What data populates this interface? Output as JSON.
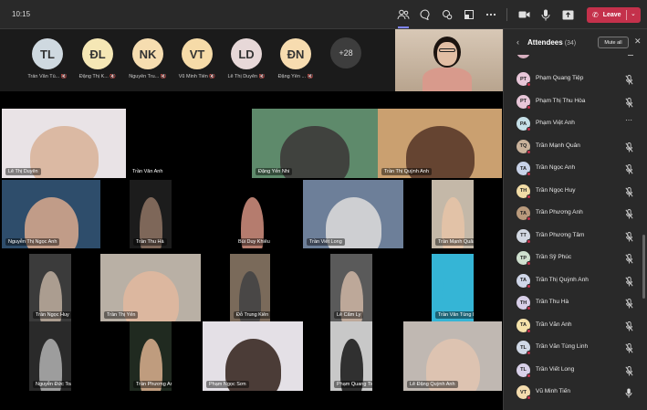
{
  "top_bar": {
    "time": "10:15",
    "leave_label": "Leave",
    "icons": [
      "people-icon",
      "chat-icon",
      "reactions-icon",
      "rooms-icon",
      "more-icon",
      "camera-icon",
      "mic-icon",
      "share-icon"
    ]
  },
  "strip": {
    "participants": [
      {
        "initials": "TL",
        "name": "Trần Văn Tù...",
        "color": "#cfd9e0"
      },
      {
        "initials": "ĐL",
        "name": "Đặng Thị K...",
        "color": "#f5e7b5"
      },
      {
        "initials": "NK",
        "name": "Nguyễn Tru...",
        "color": "#f6ddb0"
      },
      {
        "initials": "VT",
        "name": "Vũ Minh Tiến",
        "color": "#f6dba8"
      },
      {
        "initials": "LD",
        "name": "Lê Thị Duyên",
        "color": "#e7d8d8"
      },
      {
        "initials": "ĐN",
        "name": "Đặng Yến ...",
        "color": "#f7dcb0"
      }
    ],
    "more_count": "+28"
  },
  "grid": {
    "tiles": [
      {
        "name": "Lê Thị Duyên",
        "bg": "#e9e3e6",
        "skin": "#d9b49b"
      },
      {
        "name": "Trần Văn Anh",
        "bg": "#000000",
        "skin": "#000000"
      },
      {
        "name": "Đặng Yến Nhi",
        "bg": "#5e8a6b",
        "skin": "#3d3a3a"
      },
      {
        "name": "Trần Thị Quỳnh Anh",
        "bg": "#caa070",
        "skin": "#5a3a2a"
      },
      {
        "name": "Nguyễn Thị Ngọc Anh",
        "bg": "#2e4d6b",
        "skin": "#d2a58c"
      },
      {
        "name": "Trần Thu Hà",
        "bg": "#1c1c1c",
        "skin": "#8a7060"
      },
      {
        "name": "Bùi Duy Khiêu",
        "bg": "#000000",
        "skin": "#c98a7a"
      },
      {
        "name": "Trần Viết Long",
        "bg": "#6d7f99",
        "skin": "#d8d8d8"
      },
      {
        "name": "Trần Mạnh Quân",
        "bg": "#c4b8a8",
        "skin": "#e6c3a6"
      },
      {
        "name": "Trần Ngọc Huy",
        "bg": "#3b3b3b",
        "skin": "#b8a89a"
      },
      {
        "name": "Trần Thị Yến",
        "bg": "#b9b0a5",
        "skin": "#e0b89e"
      },
      {
        "name": "Đỗ Trung Kiên",
        "bg": "#7a6a5a",
        "skin": "#444444"
      },
      {
        "name": "Lê Cẩm Ly",
        "bg": "#5a5a5a",
        "skin": "#c8b0a0"
      },
      {
        "name": "Trần Văn Tùng Linh",
        "bg": "#35b5d6",
        "skin": "#35b5d6"
      },
      {
        "name": "Nguyễn Đức Toàn",
        "bg": "#2a2a2a",
        "skin": "#aaaaaa"
      },
      {
        "name": "Trần Phương Anh",
        "bg": "#202a20",
        "skin": "#d0a888"
      },
      {
        "name": "Phạm Ngọc Sơn",
        "bg": "#e4e0e6",
        "skin": "#3a2a24"
      },
      {
        "name": "Phạm Quang Tiệp",
        "bg": "#c8c8c8",
        "skin": "#1f1f1f"
      },
      {
        "name": "Lê Đặng Quỳnh Anh",
        "bg": "#c0b8b2",
        "skin": "#e0c4b0"
      }
    ]
  },
  "panel": {
    "title": "Attendees",
    "count": "(34)",
    "mute_all_label": "Mute all",
    "attendees": [
      {
        "initials": "PT",
        "name": "Phạm Quang Tiệp",
        "color": "#e8c6d8",
        "mic": "muted"
      },
      {
        "initials": "PT",
        "name": "Phạm Thị Thu Hòa",
        "color": "#e8c6d8",
        "mic": "muted"
      },
      {
        "initials": "PA",
        "name": "Phạm Việt Anh",
        "color": "#c6e0e8",
        "mic": "more"
      },
      {
        "initials": "TQ",
        "name": "Trần Mạnh Quân",
        "color": "#c9b29b",
        "mic": "muted"
      },
      {
        "initials": "TA",
        "name": "Trần Ngọc Anh",
        "color": "#c8d2e8",
        "mic": "muted"
      },
      {
        "initials": "TH",
        "name": "Trần Ngọc Huy",
        "color": "#f2dca6",
        "mic": "muted"
      },
      {
        "initials": "TA",
        "name": "Trần Phương Anh",
        "color": "#b99a7c",
        "mic": "muted"
      },
      {
        "initials": "TT",
        "name": "Trần Phương Tâm",
        "color": "#d2d8e2",
        "mic": "muted"
      },
      {
        "initials": "TP",
        "name": "Trần Sỹ Phúc",
        "color": "#cfe0cf",
        "mic": "muted"
      },
      {
        "initials": "TA",
        "name": "Trần Thị Quỳnh Anh",
        "color": "#cfd6e8",
        "mic": "muted"
      },
      {
        "initials": "TH",
        "name": "Trần Thu Hà",
        "color": "#d8cfe8",
        "mic": "muted"
      },
      {
        "initials": "TA",
        "name": "Trần Văn Anh",
        "color": "#f4e2aa",
        "mic": "muted"
      },
      {
        "initials": "TL",
        "name": "Trần Văn Tùng Linh",
        "color": "#d0d8e6",
        "mic": "muted"
      },
      {
        "initials": "TL",
        "name": "Trần Viết Long",
        "color": "#d8d0e8",
        "mic": "muted"
      },
      {
        "initials": "VT",
        "name": "Vũ Minh Tiến",
        "color": "#f4dcae",
        "mic": "on"
      }
    ]
  }
}
